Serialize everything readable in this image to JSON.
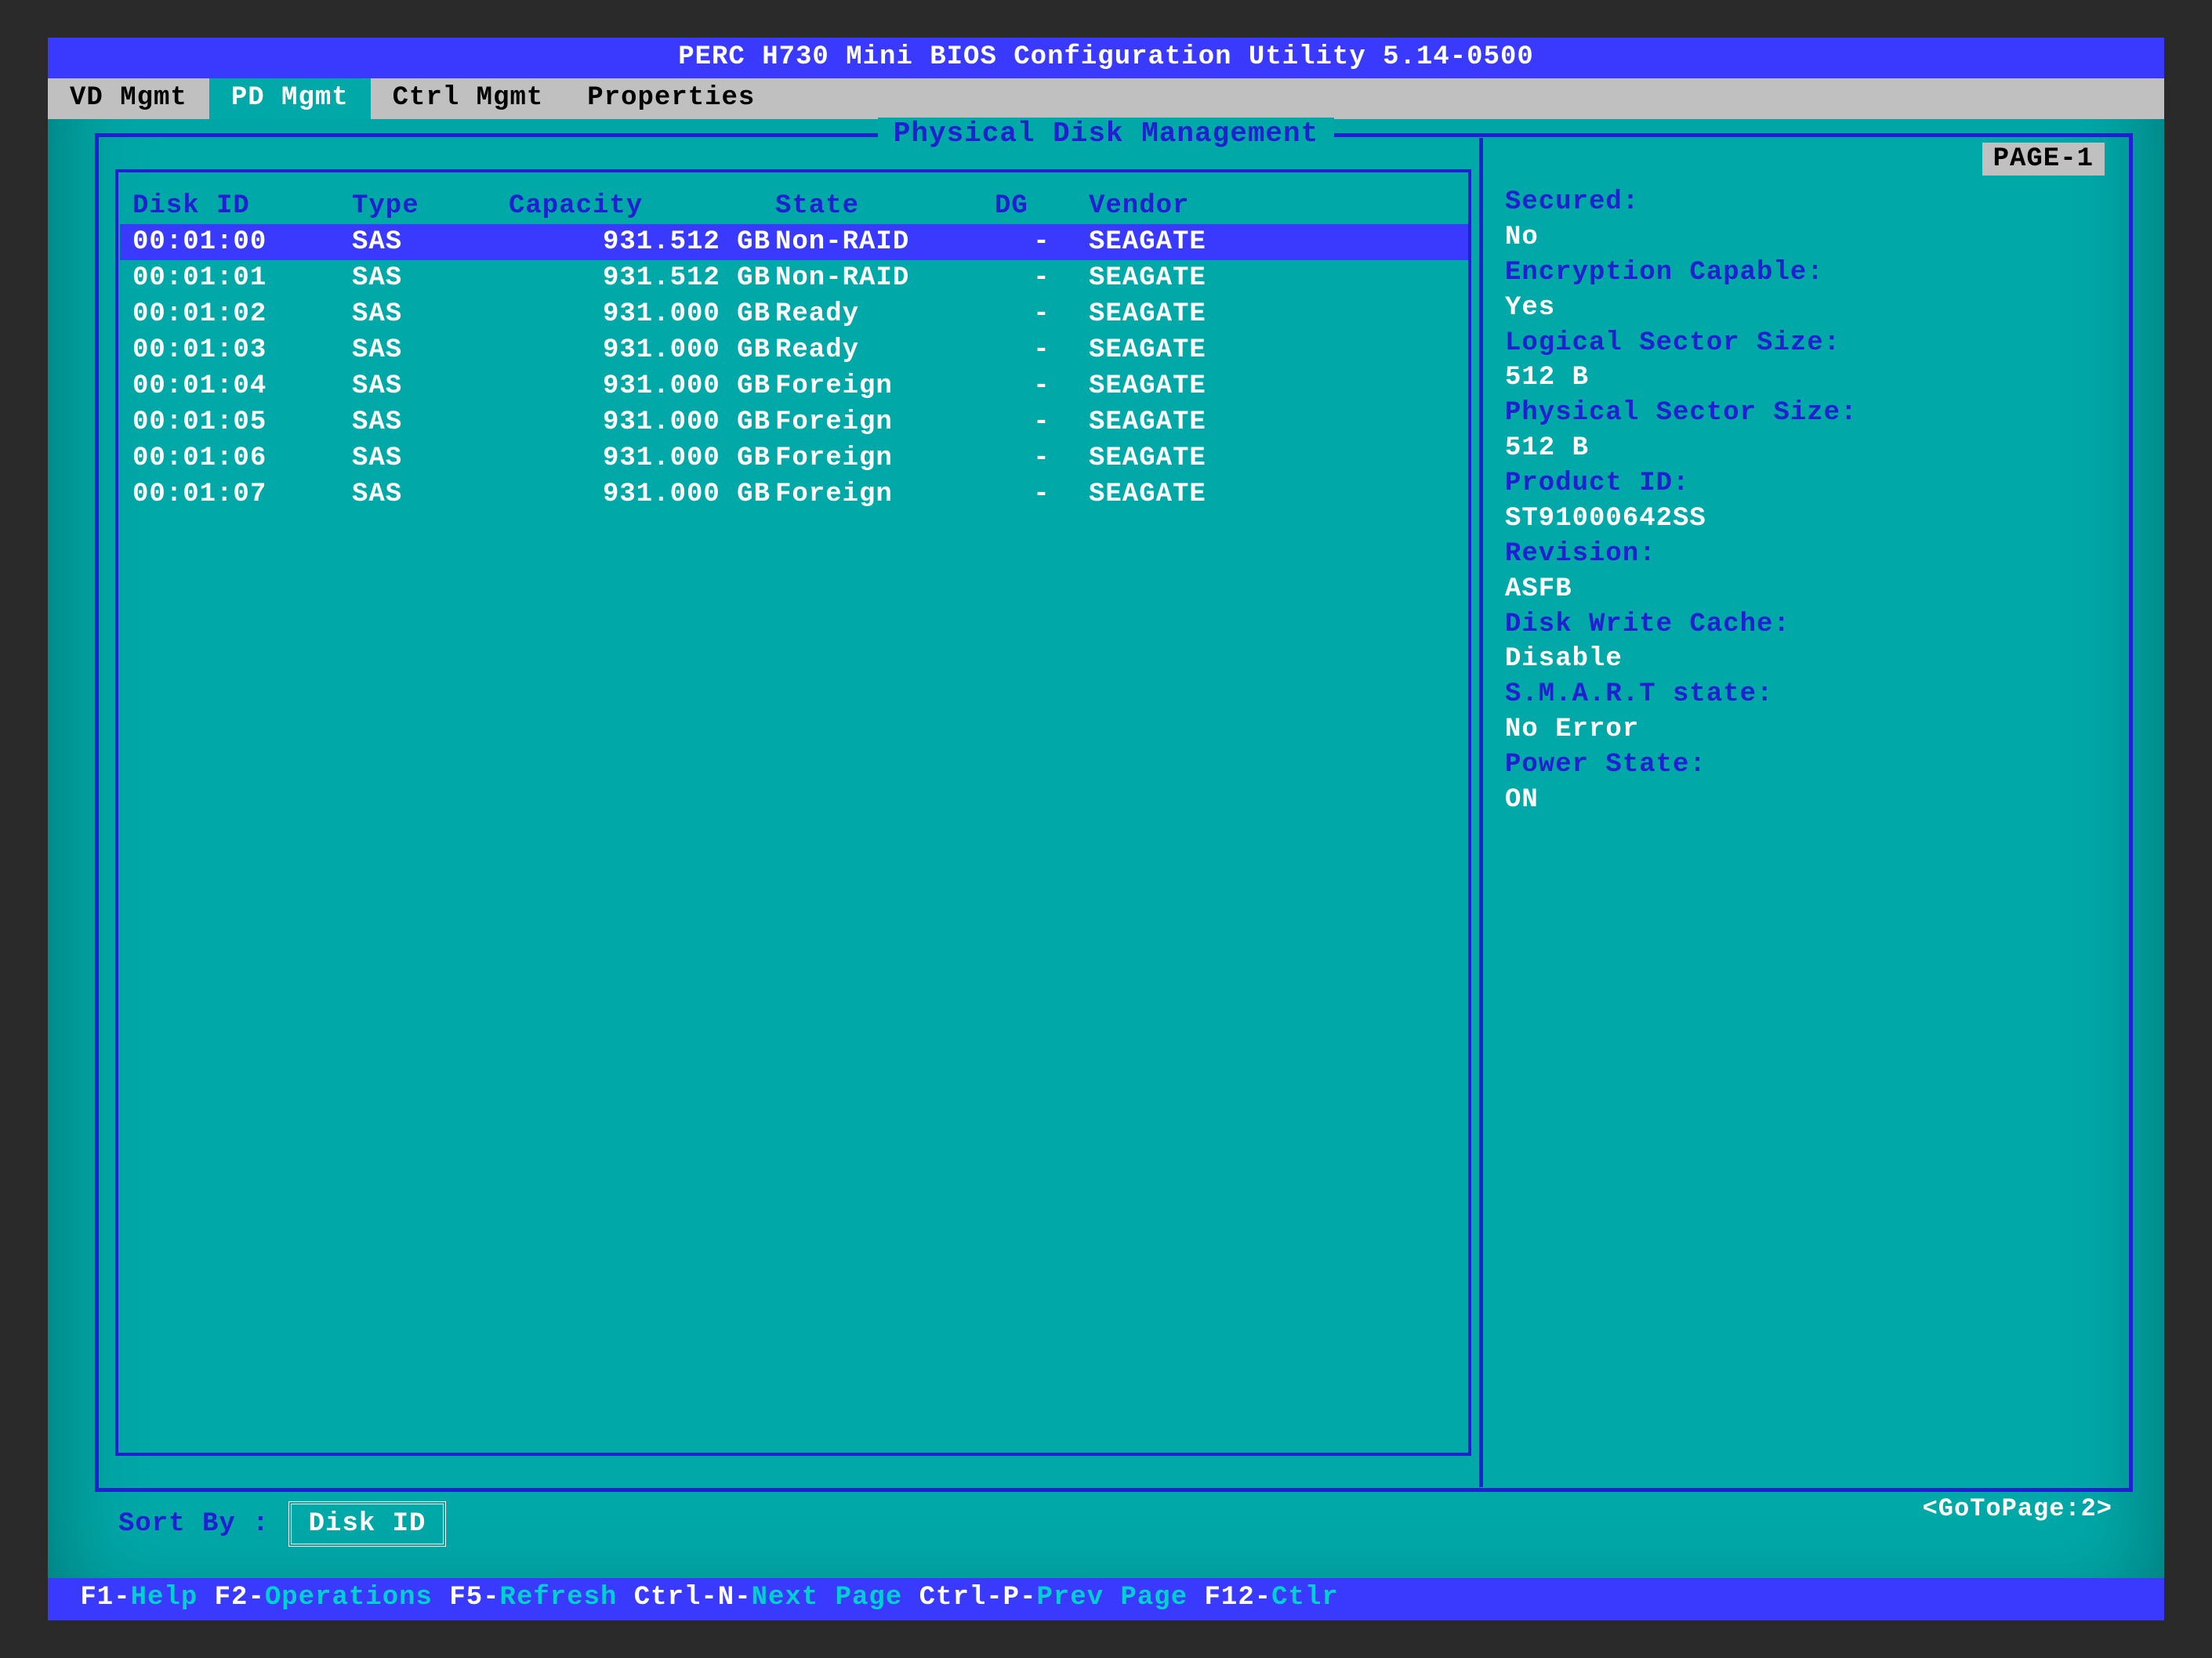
{
  "title": "PERC H730 Mini BIOS Configuration Utility 5.14-0500",
  "tabs": [
    "VD Mgmt",
    "PD Mgmt",
    "Ctrl Mgmt",
    "Properties"
  ],
  "active_tab_index": 1,
  "panel_title": "Physical Disk Management",
  "page_badge": "PAGE-1",
  "columns": {
    "disk_id": "Disk ID",
    "type": "Type",
    "capacity": "Capacity",
    "state": "State",
    "dg": "DG",
    "vendor": "Vendor"
  },
  "disks": [
    {
      "id": "00:01:00",
      "type": "SAS",
      "capacity": "931.512 GB",
      "state": "Non-RAID",
      "dg": "-",
      "vendor": "SEAGATE",
      "selected": true
    },
    {
      "id": "00:01:01",
      "type": "SAS",
      "capacity": "931.512 GB",
      "state": "Non-RAID",
      "dg": "-",
      "vendor": "SEAGATE",
      "selected": false
    },
    {
      "id": "00:01:02",
      "type": "SAS",
      "capacity": "931.000 GB",
      "state": "Ready",
      "dg": "-",
      "vendor": "SEAGATE",
      "selected": false
    },
    {
      "id": "00:01:03",
      "type": "SAS",
      "capacity": "931.000 GB",
      "state": "Ready",
      "dg": "-",
      "vendor": "SEAGATE",
      "selected": false
    },
    {
      "id": "00:01:04",
      "type": "SAS",
      "capacity": "931.000 GB",
      "state": "Foreign",
      "dg": "-",
      "vendor": "SEAGATE",
      "selected": false
    },
    {
      "id": "00:01:05",
      "type": "SAS",
      "capacity": "931.000 GB",
      "state": "Foreign",
      "dg": "-",
      "vendor": "SEAGATE",
      "selected": false
    },
    {
      "id": "00:01:06",
      "type": "SAS",
      "capacity": "931.000 GB",
      "state": "Foreign",
      "dg": "-",
      "vendor": "SEAGATE",
      "selected": false
    },
    {
      "id": "00:01:07",
      "type": "SAS",
      "capacity": "931.000 GB",
      "state": "Foreign",
      "dg": "-",
      "vendor": "SEAGATE",
      "selected": false
    }
  ],
  "properties": [
    {
      "label": "Secured:",
      "value": "No"
    },
    {
      "label": "Encryption Capable:",
      "value": "Yes"
    },
    {
      "label": "Logical Sector Size:",
      "value": "512 B"
    },
    {
      "label": "Physical Sector Size:",
      "value": "512 B"
    },
    {
      "label": "Product ID:",
      "value": "ST91000642SS"
    },
    {
      "label": "Revision:",
      "value": "ASFB"
    },
    {
      "label": "Disk Write Cache:",
      "value": "Disable"
    },
    {
      "label": "S.M.A.R.T state:",
      "value": "No Error"
    },
    {
      "label": "Power State:",
      "value": "ON"
    }
  ],
  "sort": {
    "label": "Sort By :",
    "value": "Disk ID"
  },
  "goto": "<GoToPage:2>",
  "footer": [
    {
      "key": "F1",
      "desc": "Help"
    },
    {
      "key": "F2",
      "desc": "Operations"
    },
    {
      "key": "F5",
      "desc": "Refresh"
    },
    {
      "key": "Ctrl-N",
      "desc": "Next Page"
    },
    {
      "key": "Ctrl-P",
      "desc": "Prev Page"
    },
    {
      "key": "F12",
      "desc": "Ctlr"
    }
  ]
}
